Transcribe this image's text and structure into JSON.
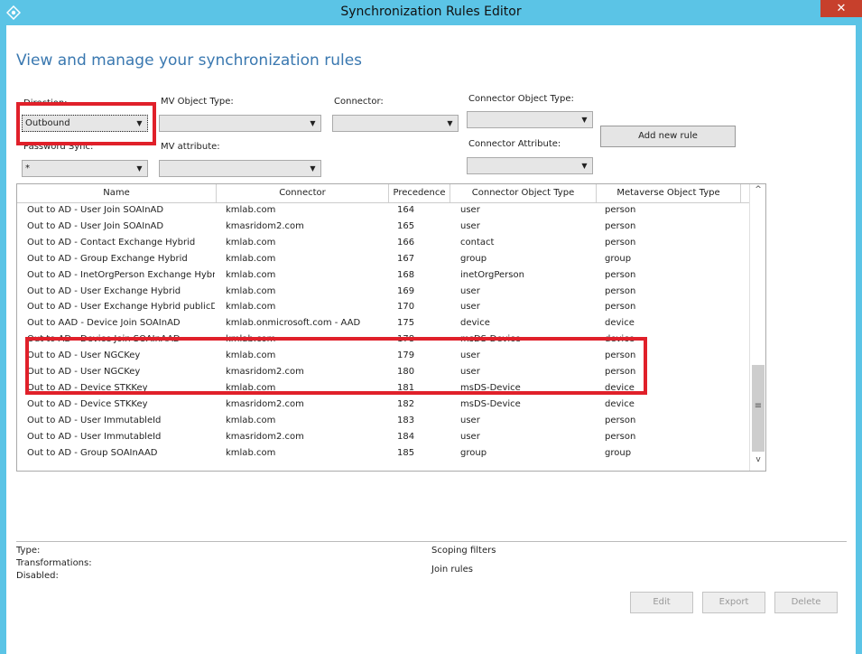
{
  "window": {
    "title": "Synchronization Rules Editor",
    "close_glyph": "✕"
  },
  "page": {
    "heading": "View and manage your synchronization rules"
  },
  "filters": {
    "direction": {
      "label": "Direction:",
      "value": "Outbound"
    },
    "password_sync": {
      "label": "Password Sync:",
      "value": "*"
    },
    "mv_object_type": {
      "label": "MV Object Type:",
      "value": ""
    },
    "mv_attribute": {
      "label": "MV attribute:",
      "value": ""
    },
    "connector": {
      "label": "Connector:",
      "value": ""
    },
    "connector_object_type": {
      "label": "Connector Object Type:",
      "value": ""
    },
    "connector_attribute": {
      "label": "Connector Attribute:",
      "value": ""
    },
    "add_rule_label": "Add new rule"
  },
  "table": {
    "columns": [
      "Name",
      "Connector",
      "Precedence",
      "Connector Object Type",
      "Metaverse Object Type"
    ],
    "rows": [
      [
        "Out to AD - User Join SOAInAD",
        "kmlab.com",
        "164",
        "user",
        "person"
      ],
      [
        "Out to AD - User Join SOAInAD",
        "kmasridom2.com",
        "165",
        "user",
        "person"
      ],
      [
        "Out to AD - Contact Exchange Hybrid",
        "kmlab.com",
        "166",
        "contact",
        "person"
      ],
      [
        "Out to AD - Group Exchange Hybrid",
        "kmlab.com",
        "167",
        "group",
        "group"
      ],
      [
        "Out to AD - InetOrgPerson Exchange Hybrid",
        "kmlab.com",
        "168",
        "inetOrgPerson",
        "person"
      ],
      [
        "Out to AD - User Exchange Hybrid",
        "kmlab.com",
        "169",
        "user",
        "person"
      ],
      [
        "Out to AD - User Exchange Hybrid publicDele",
        "kmlab.com",
        "170",
        "user",
        "person"
      ],
      [
        "Out to AAD - Device Join SOAInAD",
        "kmlab.onmicrosoft.com - AAD",
        "175",
        "device",
        "device"
      ],
      [
        "Out to AD - Device Join SOAInAAD",
        "kmlab.com",
        "178",
        "msDS-Device",
        "device"
      ],
      [
        "Out to AD - User NGCKey",
        "kmlab.com",
        "179",
        "user",
        "person"
      ],
      [
        "Out to AD - User NGCKey",
        "kmasridom2.com",
        "180",
        "user",
        "person"
      ],
      [
        "Out to AD - Device STKKey",
        "kmlab.com",
        "181",
        "msDS-Device",
        "device"
      ],
      [
        "Out to AD - Device STKKey",
        "kmasridom2.com",
        "182",
        "msDS-Device",
        "device"
      ],
      [
        "Out to AD - User ImmutableId",
        "kmlab.com",
        "183",
        "user",
        "person"
      ],
      [
        "Out to AD - User ImmutableId",
        "kmasridom2.com",
        "184",
        "user",
        "person"
      ],
      [
        "Out to AD - Group SOAInAAD",
        "kmlab.com",
        "185",
        "group",
        "group"
      ]
    ]
  },
  "details": {
    "type_label": "Type:",
    "transformations_label": "Transformations:",
    "disabled_label": "Disabled:",
    "scoping_filters_label": "Scoping filters",
    "join_rules_label": "Join rules"
  },
  "actions": {
    "edit": "Edit",
    "export": "Export",
    "delete": "Delete"
  },
  "icons": {
    "combo_arrow": "▼",
    "scroll_up": "^",
    "scroll_down": "v",
    "scroll_grip": "≡"
  },
  "colors": {
    "title_bar": "#5bc4e6",
    "heading": "#3a78b0",
    "highlight": "#e0202a",
    "close": "#c7402c"
  }
}
